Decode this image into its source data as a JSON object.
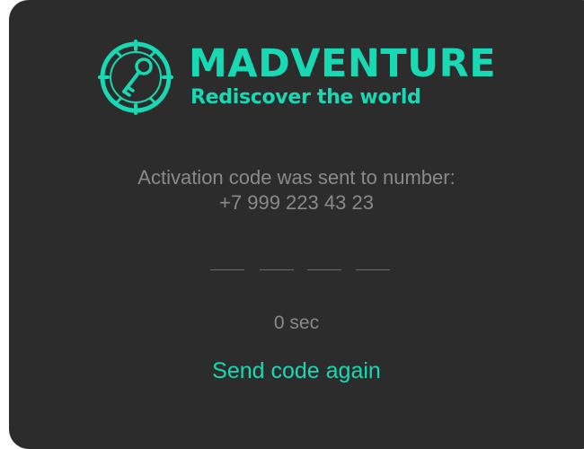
{
  "brand": {
    "name": "MADVENTURE",
    "tagline": "Rediscover the world",
    "logo_icon": "compass-key-icon",
    "accent_color": "#17d9b4"
  },
  "activation": {
    "message_line1": "Activation code was sent to number:",
    "phone_number": "+7 999 223 43 23",
    "code_digits": [
      "",
      "",
      "",
      ""
    ],
    "timer_text": "0 sec",
    "resend_label": "Send code again"
  },
  "colors": {
    "card_background": "#2c2c2c",
    "muted_text": "#8a8a8a"
  }
}
